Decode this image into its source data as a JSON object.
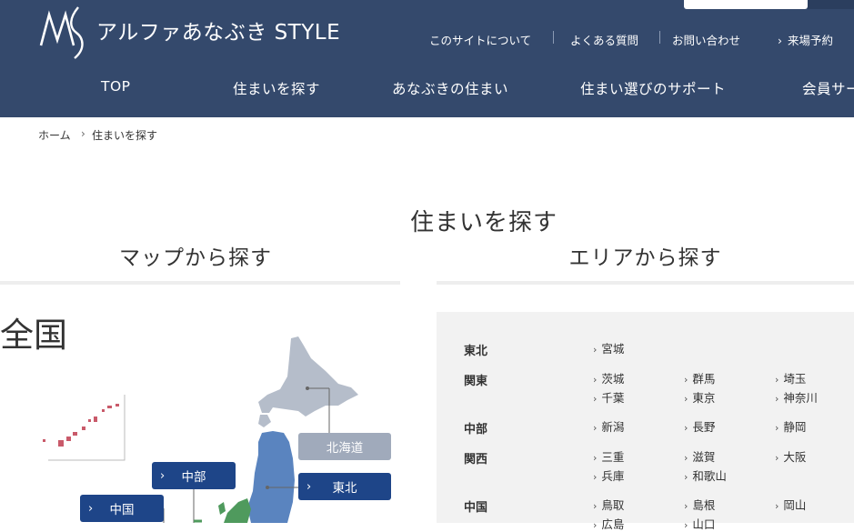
{
  "header": {
    "logo_text": "アルファあなぶき STYLE",
    "utility_links": [
      "このサイトについて",
      "よくある質問",
      "お問い合わせ"
    ],
    "visit_label": "来場予約",
    "nav": [
      "TOP",
      "住まいを探す",
      "あなぶきの住まい",
      "住まい選びのサポート",
      "会員サー"
    ]
  },
  "breadcrumb": {
    "home": "ホーム",
    "current": "住まいを探す"
  },
  "main": {
    "title": "住まいを探す",
    "map_heading": "マップから探す",
    "area_heading": "エリアから探す",
    "map_title": "全国",
    "map_regions": [
      "北海道",
      "東北",
      "中部",
      "中国"
    ]
  },
  "areas": [
    {
      "name": "東北",
      "prefs": [
        "宮城"
      ]
    },
    {
      "name": "関東",
      "prefs": [
        "茨城",
        "群馬",
        "埼玉",
        "千葉",
        "東京",
        "神奈川"
      ]
    },
    {
      "name": "中部",
      "prefs": [
        "新潟",
        "長野",
        "静岡"
      ]
    },
    {
      "name": "関西",
      "prefs": [
        "三重",
        "滋賀",
        "大阪",
        "兵庫",
        "和歌山"
      ]
    },
    {
      "name": "中国",
      "prefs": [
        "鳥取",
        "島根",
        "岡山",
        "広島",
        "山口"
      ]
    }
  ],
  "colors": {
    "header_bg": "#34496c",
    "region_button": "#1e4588",
    "region_button_inactive": "#a0aabb",
    "map_hokkaido": "#b5bdca",
    "map_tohoku": "#5a84bf",
    "map_chubu": "#4f9a5d",
    "map_okinawa": "#c95a6a"
  },
  "icons": [
    "logo-mark-icon",
    "chevron-right-icon"
  ]
}
